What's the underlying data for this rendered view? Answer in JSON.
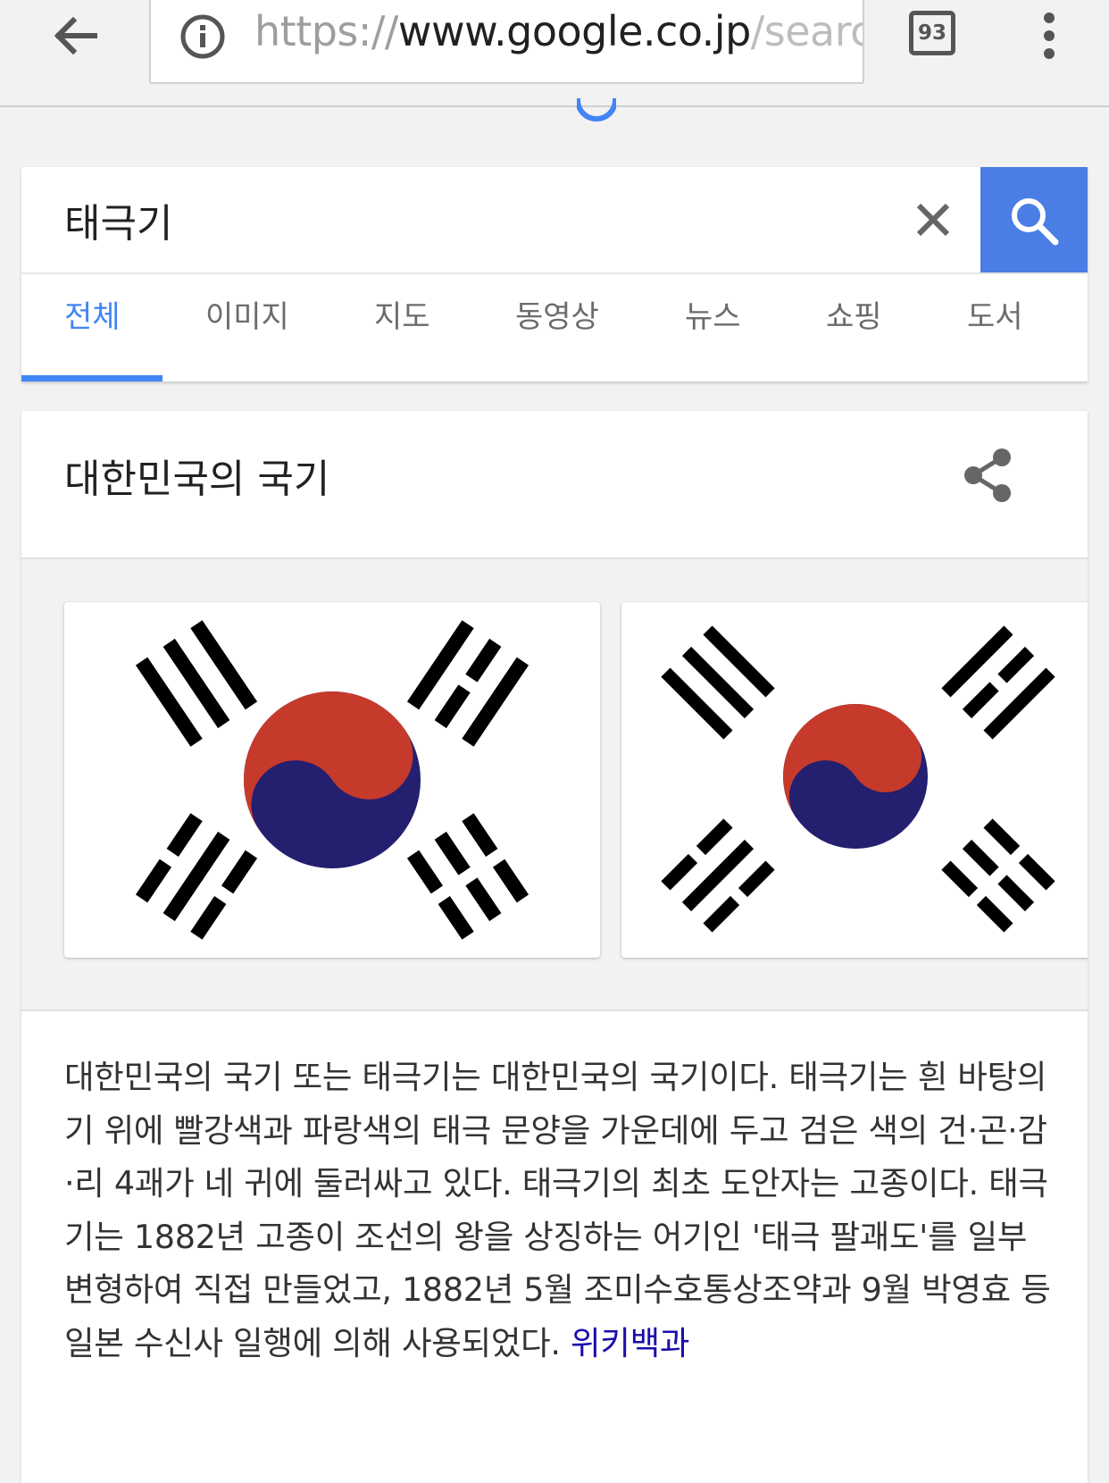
{
  "browser": {
    "url_scheme": "https://",
    "url_host": "www.google.co.jp",
    "url_path": "/searc",
    "tab_count": "93"
  },
  "search": {
    "query": "태극기"
  },
  "tabs": [
    {
      "label": "전체",
      "active": true
    },
    {
      "label": "이미지"
    },
    {
      "label": "지도"
    },
    {
      "label": "동영상"
    },
    {
      "label": "뉴스"
    },
    {
      "label": "쇼핑"
    },
    {
      "label": "도서"
    }
  ],
  "knowledge_panel": {
    "title": "대한민국의 국기",
    "description": "대한민국의 국기 또는 태극기는 대한민국의 국기이다. 태극기는 흰 바탕의 기 위에 빨강색과 파랑색의 태극 문양을 가운데에 두고 검은 색의 건·곤·감·리 4괘가 네 귀에 둘러싸고 있다. 태극기의 최초 도안자는 고종이다. 태극기는 1882년 고종이 조선의 왕을 상징하는 어기인 '태극 팔괘도'를 일부 변형하여 직접 만들었고, 1882년 5월 조미수호통상조약과 9월 박영효 등 일본 수신사 일행에 의해 사용되었다.",
    "source_link": "위키백과"
  },
  "colors": {
    "accent": "#4285f4",
    "search_button": "#4a7ee4",
    "flag_red": "#c63a2c",
    "flag_blue": "#241f6e",
    "link": "#1a0dab"
  }
}
